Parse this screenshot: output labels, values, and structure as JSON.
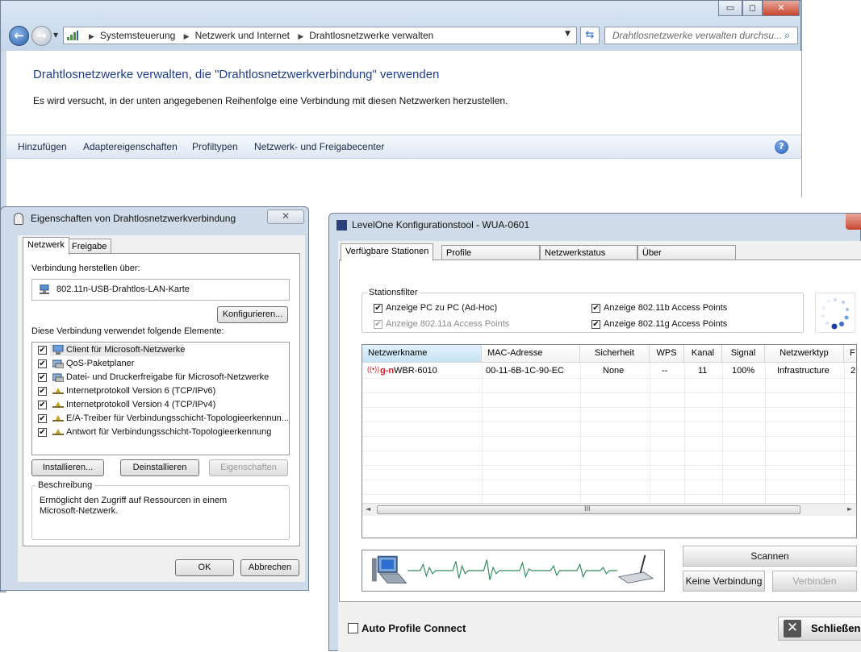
{
  "explorer": {
    "caption_buttons": [
      "▭",
      "◻",
      "✕"
    ],
    "breadcrumbs": [
      "Systemsteuerung",
      "Netzwerk und Internet",
      "Drahtlosnetzwerke verwalten"
    ],
    "search_placeholder": "Drahtlosnetzwerke verwalten durchsu...",
    "heading": "Drahtlosnetzwerke verwalten, die \"Drahtlosnetzwerkverbindung\" verwenden",
    "subtext": "Es wird versucht, in der unten angegebenen Reihenfolge eine Verbindung mit diesen Netzwerken herzustellen.",
    "commands": [
      "Hinzufügen",
      "Adaptereigenschaften",
      "Profiltypen",
      "Netzwerk- und Freigabecenter"
    ],
    "help_glyph": "?"
  },
  "props": {
    "title": "Eigenschaften von Drahtlosnetzwerkverbindung",
    "tabs": [
      "Netzwerk",
      "Freigabe"
    ],
    "connect_via_label": "Verbindung herstellen über:",
    "adapter": "802.11n-USB-Drahtlos-LAN-Karte",
    "configure_button": "Konfigurieren...",
    "elements_label": "Diese Verbindung verwendet folgende Elemente:",
    "items": [
      {
        "label": "Client für Microsoft-Netzwerke",
        "checked": true,
        "icon": "network-client-icon"
      },
      {
        "label": "QoS-Paketplaner",
        "checked": true,
        "icon": "network-service-icon"
      },
      {
        "label": "Datei- und Druckerfreigabe für Microsoft-Netzwerke",
        "checked": true,
        "icon": "network-service-icon"
      },
      {
        "label": "Internetprotokoll Version 6 (TCP/IPv6)",
        "checked": true,
        "icon": "protocol-icon"
      },
      {
        "label": "Internetprotokoll Version 4 (TCP/IPv4)",
        "checked": true,
        "icon": "protocol-icon"
      },
      {
        "label": "E/A-Treiber für Verbindungsschicht-Topologieerkennun...",
        "checked": true,
        "icon": "protocol-icon"
      },
      {
        "label": "Antwort für Verbindungsschicht-Topologieerkennung",
        "checked": true,
        "icon": "protocol-icon"
      }
    ],
    "install_button": "Installieren...",
    "uninstall_button": "Deinstallieren",
    "properties_button": "Eigenschaften",
    "description_label": "Beschreibung",
    "description_text": "Ermöglicht den Zugriff auf Ressourcen in einem Microsoft-Netzwerk.",
    "ok_button": "OK",
    "cancel_button": "Abbrechen"
  },
  "levelone": {
    "title": "LevelOne Konfigurationstool - WUA-0601",
    "tabs": [
      "Verfügbare Stationen",
      "Profile",
      "Netzwerkstatus",
      "Über"
    ],
    "filter_title": "Stationsfilter",
    "filters": [
      {
        "label": "Anzeige PC zu PC (Ad-Hoc)",
        "checked": true,
        "disabled": false
      },
      {
        "label": "Anzeige 802.11b Access Points",
        "checked": true,
        "disabled": false
      },
      {
        "label": "Anzeige 802.11a Access Points",
        "checked": true,
        "disabled": true
      },
      {
        "label": "Anzeige 802.11g Access Points",
        "checked": true,
        "disabled": false
      }
    ],
    "columns": [
      "Netzwerkname",
      "MAC-Adresse",
      "Sicherheit",
      "WPS",
      "Kanal",
      "Signal",
      "Netzwerktyp",
      "F"
    ],
    "rows": [
      {
        "badge": "g-n",
        "name": "WBR-6010",
        "mac": "00-11-6B-1C-90-EC",
        "security": "None",
        "wps": "--",
        "channel": "11",
        "signal": "100%",
        "type": "Infrastructure",
        "extra": "2"
      }
    ],
    "scroll_grip": "III",
    "scan_button": "Scannen",
    "disconnect_button": "Keine Verbindung",
    "connect_button": "Verbinden",
    "auto_profile_label": "Auto Profile Connect",
    "close_button": "Schließen",
    "colors": {
      "badge_red": "#d0202a",
      "accent_blue": "#1e3f8f"
    }
  }
}
